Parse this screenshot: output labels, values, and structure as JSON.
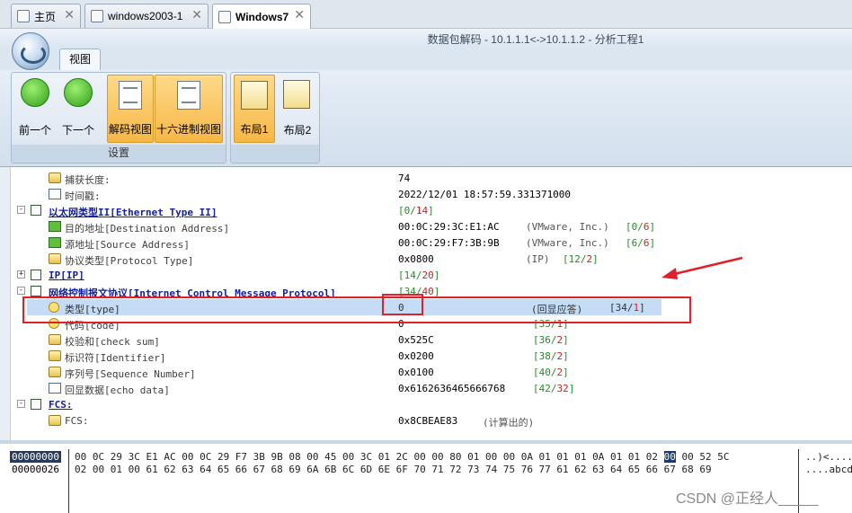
{
  "browser_tabs": [
    {
      "label": "主页",
      "active": false
    },
    {
      "label": "windows2003-1",
      "active": false
    },
    {
      "label": "Windows7",
      "active": true
    }
  ],
  "tab_close_glyph": "✕",
  "window": {
    "title": "数据包解码 - 10.1.1.1<->10.1.1.2 - 分析工程1"
  },
  "ribbon": {
    "tab_label": "视图",
    "groups": [
      {
        "caption": "设置",
        "buttons": [
          "前一个",
          "下一个",
          "解码视图",
          "十六进制视图"
        ]
      },
      {
        "caption": "",
        "buttons": [
          "布局1",
          "布局2"
        ]
      }
    ]
  },
  "tree": {
    "rows": [
      {
        "label": "捕获长度:",
        "value": "74",
        "note": "",
        "pos_a": "",
        "pos_b": ""
      },
      {
        "label": "时间戳:",
        "value": "2022/12/01 18:57:59.331371000",
        "note": "",
        "pos_a": "",
        "pos_b": ""
      },
      {
        "label": "以太网类型II[Ethernet Type II]",
        "value": "",
        "note": "",
        "pos_a": "0",
        "pos_b": "14"
      },
      {
        "label": "目的地址[Destination Address]",
        "value": "00:0C:29:3C:E1:AC",
        "note": "(VMware, Inc.)",
        "pos_a": "0",
        "pos_b": "6"
      },
      {
        "label": "源地址[Source Address]",
        "value": "00:0C:29:F7:3B:9B",
        "note": "(VMware, Inc.)",
        "pos_a": "6",
        "pos_b": "6"
      },
      {
        "label": "协议类型[Protocol Type]",
        "value": "0x0800",
        "note": "(IP)",
        "pos_a": "12",
        "pos_b": "2"
      },
      {
        "label": "IP[IP]",
        "value": "",
        "note": "",
        "pos_a": "14",
        "pos_b": "20"
      },
      {
        "label": "网络控制报文协议[Internet Control Message Protocol]",
        "value": "",
        "note": "",
        "pos_a": "34",
        "pos_b": "40"
      },
      {
        "label": "类型[type]",
        "value": "0",
        "note": "(回显应答)",
        "pos_a": "34",
        "pos_b": "1"
      },
      {
        "label": "代码[code]",
        "value": "0",
        "note": "",
        "pos_a": "35",
        "pos_b": "1"
      },
      {
        "label": "校验和[check sum]",
        "value": "0x525C",
        "note": "",
        "pos_a": "36",
        "pos_b": "2"
      },
      {
        "label": "标识符[Identifier]",
        "value": "0x0200",
        "note": "",
        "pos_a": "38",
        "pos_b": "2"
      },
      {
        "label": "序列号[Sequence Number]",
        "value": "0x0100",
        "note": "",
        "pos_a": "40",
        "pos_b": "2"
      },
      {
        "label": "回显数据[echo data]",
        "value": "0x6162636465666768",
        "note": "",
        "pos_a": "42",
        "pos_b": "32"
      },
      {
        "label": "FCS:",
        "value": "",
        "note": "",
        "pos_a": "",
        "pos_b": ""
      },
      {
        "label": "FCS:",
        "value": "0x8CBEAE83",
        "note": "(计算出的)",
        "pos_a": "",
        "pos_b": ""
      }
    ],
    "expander_closed": "+",
    "expander_open": "-"
  },
  "hex": {
    "lines": [
      {
        "offset": "00000000",
        "bytes_pre": "00 0C 29 3C E1 AC 00 0C 29 F7 3B 9B 08 00 45 00 3C 01 2C 00 00 80 01 00 00 0A 01 01 01 0A 01 01 02 ",
        "bytes_hl": "00",
        "bytes_post": " 00 52 5C",
        "ascii": "..)<...."
      },
      {
        "offset": "00000026",
        "bytes_pre": "02 00 01 00 61 62 63 64 65 66 67 68 69 6A 6B 6C 6D 6E 6F 70 71 72 73 74 75 76 77 61 62 63 64 65 66 67 68 69",
        "bytes_hl": "",
        "bytes_post": "",
        "ascii": "....abcd"
      }
    ]
  },
  "watermark": "CSDN @正经人_____",
  "colors": {
    "annotation": "#e0202a",
    "selection": "#c5dcf6",
    "section_text": "#111fa0"
  }
}
